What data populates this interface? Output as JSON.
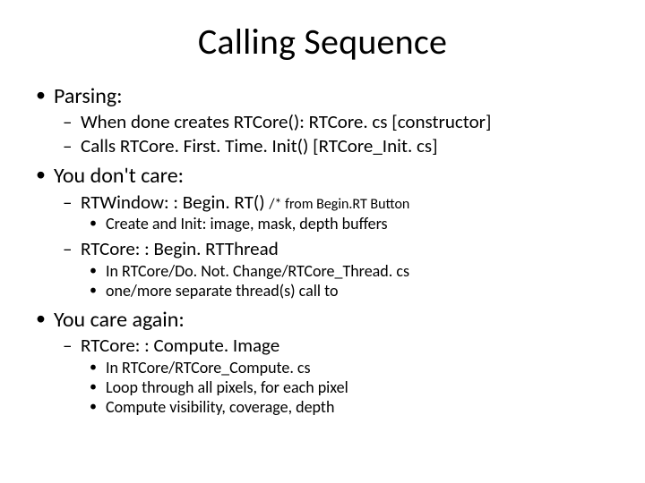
{
  "title": "Calling Sequence",
  "b1": {
    "label": "Parsing:",
    "s1": "When done creates RTCore(): RTCore. cs [constructor]",
    "s2": "Calls RTCore. First. Time. Init() [RTCore_Init. cs]"
  },
  "b2": {
    "label": "You don't care:",
    "s1": "RTWindow: : Begin. RT()",
    "s1_note": "/* from Begin.RT Button",
    "s1_c1": "Create and Init: image, mask, depth buffers",
    "s2": "RTCore: : Begin. RTThread",
    "s2_c1": "In RTCore/Do. Not. Change/RTCore_Thread. cs",
    "s2_c2": "one/more separate thread(s) call to"
  },
  "b3": {
    "label": "You care again:",
    "s1": "RTCore: : Compute. Image",
    "s1_c1": "In RTCore/RTCore_Compute. cs",
    "s1_c2": "Loop through all pixels, for each pixel",
    "s1_c3": "Compute visibility, coverage, depth"
  }
}
